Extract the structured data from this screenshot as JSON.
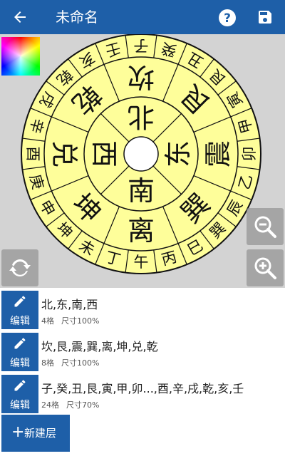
{
  "app": {
    "title": "未命名"
  },
  "compass": {
    "center_fill": "#ffffff",
    "disc_fill": "#fefe9a",
    "line_color": "#111111",
    "ring1": [
      "北",
      "东",
      "南",
      "西"
    ],
    "ring2": [
      "坎",
      "艮",
      "震",
      "巽",
      "离",
      "坤",
      "兑",
      "乾"
    ],
    "ring3": [
      "子",
      "癸",
      "丑",
      "艮",
      "寅",
      "甲",
      "卯",
      "乙",
      "辰",
      "巽",
      "巳",
      "丙",
      "午",
      "丁",
      "未",
      "坤",
      "申",
      "庚",
      "酉",
      "辛",
      "戌",
      "乾",
      "亥",
      "壬"
    ]
  },
  "layers": [
    {
      "names": "北,东,南,西",
      "count": "4格",
      "size": "尺寸100%",
      "edit_label": "编辑"
    },
    {
      "names": "坎,艮,震,巽,离,坤,兑,乾",
      "count": "8格",
      "size": "尺寸100%",
      "edit_label": "编辑"
    },
    {
      "names": "子,癸,丑,艮,寅,甲,卯...,酉,辛,戌,乾,亥,壬",
      "count": "24格",
      "size": "尺寸70%",
      "edit_label": "编辑"
    }
  ],
  "new_layer_label": "新建层",
  "colors": {
    "appbar": "#1e5fa8",
    "button": "#1e5fa8"
  }
}
